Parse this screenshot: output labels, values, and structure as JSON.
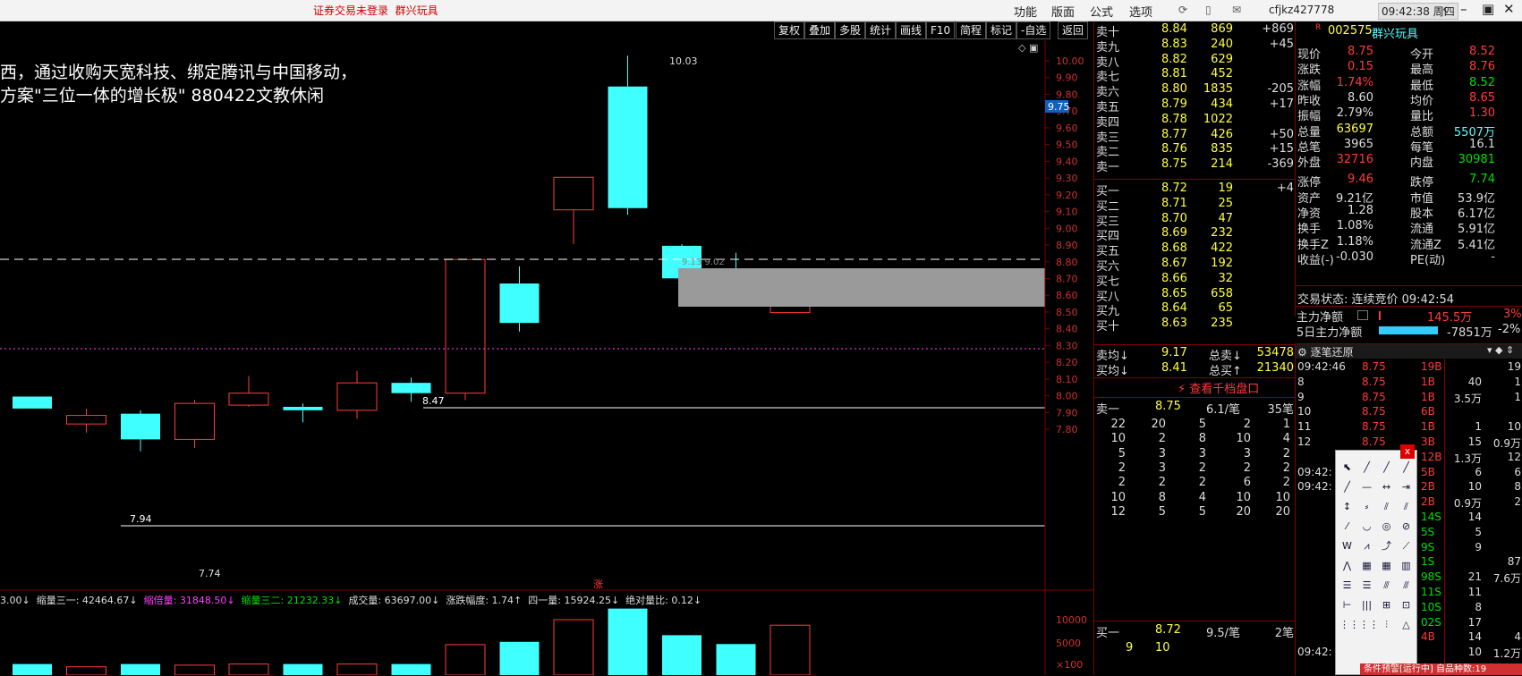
{
  "titlebar": {
    "notice": "证券交易未登录",
    "stock_name": "群兴玩具",
    "menus": [
      "功能",
      "版面",
      "公式",
      "选项"
    ],
    "user": "cfjkz427778",
    "clock": "09:42:38 周四"
  },
  "toolbar": [
    "复权",
    "叠加",
    "多股",
    "统计",
    "画线",
    "F10",
    "简程",
    "标记",
    "-自选",
    "返回"
  ],
  "announcement": [
    "西，通过收购天宽科技、绑定腾讯与中国移动，",
    "方案\"三位一体的增长极\" 880422文教休闲"
  ],
  "price_axis": [
    "10.00",
    "9.90",
    "9.80",
    "9.70",
    "9.60",
    "9.50",
    "9.40",
    "9.30",
    "9.20",
    "9.10",
    "9.00",
    "8.90",
    "8.80",
    "8.70",
    "8.60",
    "8.50",
    "8.40",
    "8.30",
    "8.20",
    "8.10",
    "8.00",
    "7.90",
    "7.80"
  ],
  "vol_axis": [
    "10000",
    "5000",
    "×100"
  ],
  "chart_labels": {
    "high": "10.03",
    "low": "7.74",
    "line1": "8.47",
    "line2": "7.94",
    "current": "9.75",
    "dash_label": "9.13 9.02",
    "zhang": "涨"
  },
  "chart_data": {
    "type": "candlestick",
    "ylim": [
      7.7,
      10.05
    ],
    "candles": [
      {
        "open": 7.97,
        "close": 8.04,
        "high": 8.04,
        "low": 7.97,
        "up": false
      },
      {
        "open": 7.88,
        "close": 7.93,
        "high": 7.97,
        "low": 7.83,
        "up": true
      },
      {
        "open": 7.94,
        "close": 7.79,
        "high": 7.96,
        "low": 7.72,
        "up": false
      },
      {
        "open": 7.79,
        "close": 8.0,
        "high": 8.02,
        "low": 7.74,
        "up": true
      },
      {
        "open": 7.99,
        "close": 8.06,
        "high": 8.16,
        "low": 7.98,
        "up": true
      },
      {
        "open": 7.98,
        "close": 7.96,
        "high": 8.0,
        "low": 7.89,
        "up": false
      },
      {
        "open": 7.96,
        "close": 8.12,
        "high": 8.19,
        "low": 7.91,
        "up": true
      },
      {
        "open": 8.12,
        "close": 8.06,
        "high": 8.15,
        "low": 8.01,
        "up": false
      },
      {
        "open": 8.06,
        "close": 8.84,
        "high": 8.84,
        "low": 8.02,
        "up": true
      },
      {
        "open": 8.7,
        "close": 8.47,
        "high": 8.8,
        "low": 8.42,
        "up": false
      },
      {
        "open": 9.13,
        "close": 9.32,
        "high": 9.32,
        "low": 8.93,
        "up": true
      },
      {
        "open": 9.85,
        "close": 9.14,
        "high": 10.03,
        "low": 9.1,
        "up": false
      },
      {
        "open": 8.92,
        "close": 8.73,
        "high": 8.93,
        "low": 8.7,
        "up": false
      },
      {
        "open": 8.74,
        "close": 8.6,
        "high": 8.88,
        "low": 8.6,
        "up": false
      },
      {
        "open": 8.53,
        "close": 8.76,
        "high": 8.77,
        "low": 8.53,
        "up": true
      }
    ],
    "volumes": [
      2000,
      1500,
      2000,
      1800,
      2000,
      2000,
      2000,
      2000,
      5500,
      6000,
      10000,
      12000,
      7200,
      5600,
      9000
    ]
  },
  "indicators": [
    {
      "text": "3.00↓",
      "color": "#ddd"
    },
    {
      "text": "缩量三一: 42464.67↓",
      "color": "#ddd"
    },
    {
      "text": "缩倍量: 31848.50↓",
      "color": "#ff40ff"
    },
    {
      "text": "缩量三二: 21232.33↓",
      "color": "#00e000"
    },
    {
      "text": "成交量: 63697.00↓",
      "color": "#ddd"
    },
    {
      "text": "涨跌幅度: 1.74↑",
      "color": "#ddd"
    },
    {
      "text": "四一量: 15924.25↓",
      "color": "#ddd"
    },
    {
      "text": "绝对量比: 0.12↓",
      "color": "#ddd"
    }
  ],
  "order_book": {
    "sell": [
      [
        "卖十",
        "8.84",
        "869",
        "+869"
      ],
      [
        "卖九",
        "8.83",
        "240",
        "+45"
      ],
      [
        "卖八",
        "8.82",
        "629",
        ""
      ],
      [
        "卖七",
        "8.81",
        "452",
        ""
      ],
      [
        "卖六",
        "8.80",
        "1835",
        "-205"
      ],
      [
        "卖五",
        "8.79",
        "434",
        "+17"
      ],
      [
        "卖四",
        "8.78",
        "1022",
        ""
      ],
      [
        "卖三",
        "8.77",
        "426",
        "+50"
      ],
      [
        "卖二",
        "8.76",
        "835",
        "+15"
      ],
      [
        "卖一",
        "8.75",
        "214",
        "-369"
      ]
    ],
    "buy": [
      [
        "买一",
        "8.72",
        "19",
        "+4"
      ],
      [
        "买二",
        "8.71",
        "25",
        ""
      ],
      [
        "买三",
        "8.70",
        "47",
        ""
      ],
      [
        "买四",
        "8.69",
        "232",
        ""
      ],
      [
        "买五",
        "8.68",
        "422",
        ""
      ],
      [
        "买六",
        "8.67",
        "192",
        ""
      ],
      [
        "买七",
        "8.66",
        "32",
        ""
      ],
      [
        "买八",
        "8.65",
        "658",
        ""
      ],
      [
        "买九",
        "8.64",
        "65",
        ""
      ],
      [
        "买十",
        "8.63",
        "235",
        ""
      ]
    ],
    "avg": [
      [
        "卖均",
        "9.17",
        "总卖",
        "53478"
      ],
      [
        "买均",
        "8.41",
        "总买",
        "21340"
      ]
    ],
    "link": "查看千档盘口",
    "queue_header": [
      "卖一",
      "8.75",
      "6.1/笔",
      "35笔"
    ],
    "queue": [
      [
        "22",
        "20",
        "5",
        "2",
        "1"
      ],
      [
        "10",
        "2",
        "8",
        "10",
        "4"
      ],
      [
        "5",
        "3",
        "3",
        "3",
        "2"
      ],
      [
        "2",
        "3",
        "2",
        "2",
        "2"
      ],
      [
        "2",
        "2",
        "2",
        "6",
        "2"
      ],
      [
        "10",
        "8",
        "4",
        "10",
        "10"
      ],
      [
        "12",
        "5",
        "5",
        "20",
        "20"
      ]
    ],
    "buy_header": [
      "买一",
      "8.72",
      "9.5/笔",
      "2笔"
    ],
    "buy_queue": [
      "9",
      "10"
    ]
  },
  "quote": {
    "code": "002575",
    "name": "群兴玩具",
    "r": "R",
    "rows": [
      [
        "现价",
        "8.75",
        "今开",
        "8.52"
      ],
      [
        "涨跌",
        "0.15",
        "最高",
        "8.76"
      ],
      [
        "涨幅",
        "1.74%",
        "最低",
        "8.52"
      ],
      [
        "昨收",
        "8.60",
        "均价",
        "8.65"
      ],
      [
        "振幅",
        "2.79%",
        "量比",
        "1.30"
      ],
      [
        "总量",
        "63697",
        "总额",
        "5507万"
      ],
      [
        "总笔",
        "3965",
        "每笔",
        "16.1"
      ],
      [
        "外盘",
        "32716",
        "内盘",
        "30981"
      ],
      [
        "涨停",
        "9.46",
        "跌停",
        "7.74"
      ],
      [
        "资产",
        "9.21亿",
        "市值",
        "53.9亿"
      ],
      [
        "净资",
        "1.28",
        "股本",
        "6.17亿"
      ],
      [
        "换手",
        "1.08%",
        "流通",
        "5.91亿"
      ],
      [
        "换手Z",
        "1.18%",
        "流通Z",
        "5.41亿"
      ],
      [
        "收益(-)",
        "-0.030",
        "PE(动)",
        "-"
      ]
    ],
    "status": "交易状态: 连续竞价 09:42:54",
    "main_flow": [
      "主力净额",
      "145.5万",
      "3%"
    ],
    "main_flow5": [
      "5日主力净额",
      "-7851万",
      "-2%"
    ]
  },
  "ticks": {
    "title": "逐笔还原",
    "rows": [
      [
        "09:42:46",
        "8.75",
        "19B"
      ],
      [
        "8",
        "8.75",
        "1B"
      ],
      [
        "9",
        "8.75",
        "1B"
      ],
      [
        "10",
        "8.75",
        "6B"
      ],
      [
        "11",
        "8.75",
        "1B"
      ],
      [
        "12",
        "8.75",
        "3B"
      ],
      [
        "",
        "",
        "12B"
      ],
      [
        "09:42:",
        "",
        "5B"
      ],
      [
        "09:42:",
        "",
        "2B"
      ],
      [
        "",
        "",
        "2B"
      ],
      [
        "",
        "",
        "14S"
      ],
      [
        "",
        "",
        "5S"
      ],
      [
        "",
        "",
        "9S"
      ],
      [
        "",
        "",
        "1S"
      ],
      [
        "",
        "",
        "98S"
      ],
      [
        "",
        "",
        "11S"
      ],
      [
        "",
        "",
        "10S"
      ],
      [
        "",
        "",
        "02S"
      ],
      [
        "",
        "",
        "4B"
      ],
      [
        "09:42:",
        "",
        ""
      ]
    ],
    "side": [
      [
        "",
        "19"
      ],
      [
        "40",
        "1"
      ],
      [
        "3.5万",
        "1"
      ],
      [
        "",
        ""
      ],
      [
        "1",
        "10"
      ],
      [
        "15",
        "0.9万"
      ],
      [
        "1.3万",
        "12"
      ],
      [
        "6",
        "6"
      ],
      [
        "10",
        "8"
      ],
      [
        "0.9万",
        "2"
      ],
      [
        "14",
        ""
      ],
      [
        "5",
        ""
      ],
      [
        "9",
        ""
      ],
      [
        "",
        "87"
      ],
      [
        "21",
        "7.6万"
      ],
      [
        "11",
        ""
      ],
      [
        "8",
        ""
      ],
      [
        "17",
        ""
      ],
      [
        "14",
        "4"
      ],
      [
        "10",
        "1.2万"
      ]
    ]
  },
  "statusbar": "条件预警[运行中] 自品种数:19"
}
